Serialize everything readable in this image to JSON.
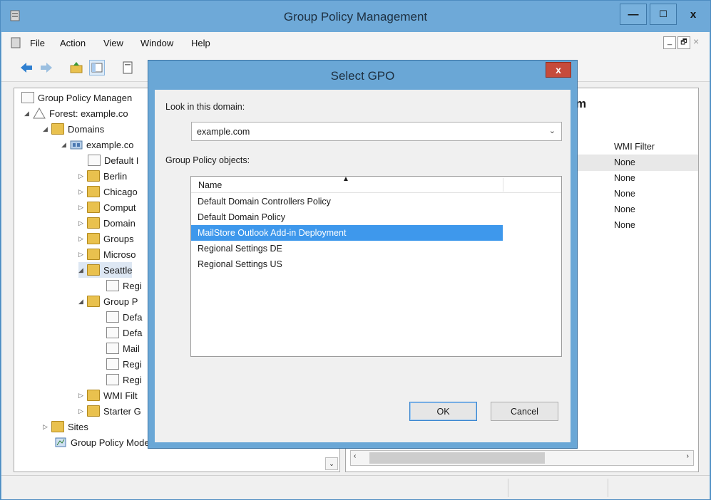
{
  "window": {
    "title": "Group Policy Management",
    "controls": {
      "minimize": "—",
      "maximize": "☐",
      "close": "x"
    }
  },
  "menubar": {
    "items": [
      "File",
      "Action",
      "View",
      "Window",
      "Help"
    ],
    "mdi_controls": {
      "minimize": "_",
      "restore": "🗗",
      "close": "×"
    }
  },
  "toolbar": {
    "icons": [
      "back-icon",
      "forward-icon",
      "up-folder-icon",
      "show-hide-tree-icon",
      "properties-icon"
    ]
  },
  "tree": {
    "items": [
      {
        "label": "Group Policy Managen",
        "icon": "gpm-icon",
        "arrow": ""
      },
      {
        "label": "Forest: example.co",
        "icon": "forest-icon",
        "arrow": "◢"
      },
      {
        "label": "Domains",
        "icon": "domains-icon",
        "arrow": "◢"
      },
      {
        "label": "example.co",
        "icon": "domain-icon",
        "arrow": "◢"
      },
      {
        "label": "Default I",
        "icon": "gpo-link-icon",
        "arrow": ""
      },
      {
        "label": "Berlin",
        "icon": "ou-folder-icon",
        "arrow": "▷"
      },
      {
        "label": "Chicago",
        "icon": "ou-folder-icon",
        "arrow": "▷"
      },
      {
        "label": "Comput",
        "icon": "ou-folder-icon",
        "arrow": "▷"
      },
      {
        "label": "Domain",
        "icon": "ou-folder-icon",
        "arrow": "▷"
      },
      {
        "label": "Groups",
        "icon": "ou-folder-icon",
        "arrow": "▷"
      },
      {
        "label": "Microso",
        "icon": "ou-folder-icon",
        "arrow": "▷"
      },
      {
        "label": "Seattle",
        "icon": "ou-folder-icon",
        "arrow": "◢"
      },
      {
        "label": "Regi",
        "icon": "gpo-link-icon",
        "arrow": ""
      },
      {
        "label": "Group P",
        "icon": "gpo-container-icon",
        "arrow": "◢"
      },
      {
        "label": "Defa",
        "icon": "gpo-icon",
        "arrow": ""
      },
      {
        "label": "Defa",
        "icon": "gpo-icon",
        "arrow": ""
      },
      {
        "label": "Mail",
        "icon": "gpo-icon",
        "arrow": ""
      },
      {
        "label": "Regi",
        "icon": "gpo-icon",
        "arrow": ""
      },
      {
        "label": "Regi",
        "icon": "gpo-icon",
        "arrow": ""
      },
      {
        "label": "WMI Filt",
        "icon": "wmi-filter-icon",
        "arrow": "▷"
      },
      {
        "label": "Starter G",
        "icon": "starter-gpo-icon",
        "arrow": "▷"
      },
      {
        "label": "Sites",
        "icon": "sites-icon",
        "arrow": "▷"
      },
      {
        "label": "Group Policy Modeling",
        "icon": "modeling-icon",
        "arrow": ""
      }
    ]
  },
  "right_pane": {
    "heading_fragment": "m",
    "wmi_header": "WMI Filter",
    "wmi_values": [
      "None",
      "None",
      "None",
      "None",
      "None"
    ]
  },
  "dialog": {
    "title": "Select GPO",
    "close": "x",
    "look_in_label": "Look in this domain:",
    "domain_value": "example.com",
    "gpo_list_label": "Group Policy objects:",
    "column_name": "Name",
    "gpos": [
      "Default Domain Controllers Policy",
      "Default Domain Policy",
      "MailStore Outlook Add-in Deployment",
      "Regional Settings DE",
      "Regional Settings US"
    ],
    "selected_index": 2,
    "ok_label": "OK",
    "cancel_label": "Cancel"
  },
  "colors": {
    "title_bar": "#6ea9d8",
    "selection": "#3e98ec",
    "close_red": "#c64b3b"
  }
}
